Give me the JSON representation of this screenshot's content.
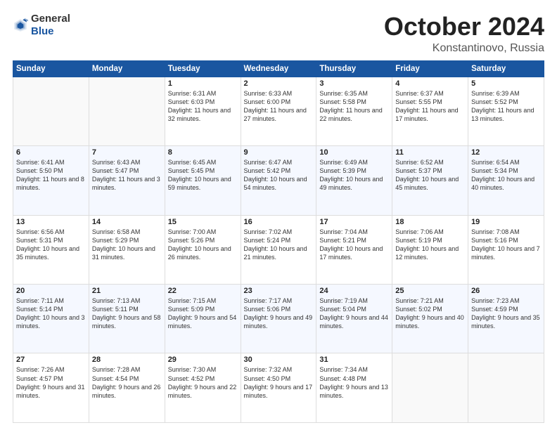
{
  "header": {
    "logo_general": "General",
    "logo_blue": "Blue",
    "month": "October 2024",
    "location": "Konstantinovo, Russia"
  },
  "weekdays": [
    "Sunday",
    "Monday",
    "Tuesday",
    "Wednesday",
    "Thursday",
    "Friday",
    "Saturday"
  ],
  "weeks": [
    [
      {
        "day": "",
        "empty": true
      },
      {
        "day": "",
        "empty": true
      },
      {
        "day": "1",
        "sunrise": "6:31 AM",
        "sunset": "6:03 PM",
        "daylight": "11 hours and 32 minutes."
      },
      {
        "day": "2",
        "sunrise": "6:33 AM",
        "sunset": "6:00 PM",
        "daylight": "11 hours and 27 minutes."
      },
      {
        "day": "3",
        "sunrise": "6:35 AM",
        "sunset": "5:58 PM",
        "daylight": "11 hours and 22 minutes."
      },
      {
        "day": "4",
        "sunrise": "6:37 AM",
        "sunset": "5:55 PM",
        "daylight": "11 hours and 17 minutes."
      },
      {
        "day": "5",
        "sunrise": "6:39 AM",
        "sunset": "5:52 PM",
        "daylight": "11 hours and 13 minutes."
      }
    ],
    [
      {
        "day": "6",
        "sunrise": "6:41 AM",
        "sunset": "5:50 PM",
        "daylight": "11 hours and 8 minutes."
      },
      {
        "day": "7",
        "sunrise": "6:43 AM",
        "sunset": "5:47 PM",
        "daylight": "11 hours and 3 minutes."
      },
      {
        "day": "8",
        "sunrise": "6:45 AM",
        "sunset": "5:45 PM",
        "daylight": "10 hours and 59 minutes."
      },
      {
        "day": "9",
        "sunrise": "6:47 AM",
        "sunset": "5:42 PM",
        "daylight": "10 hours and 54 minutes."
      },
      {
        "day": "10",
        "sunrise": "6:49 AM",
        "sunset": "5:39 PM",
        "daylight": "10 hours and 49 minutes."
      },
      {
        "day": "11",
        "sunrise": "6:52 AM",
        "sunset": "5:37 PM",
        "daylight": "10 hours and 45 minutes."
      },
      {
        "day": "12",
        "sunrise": "6:54 AM",
        "sunset": "5:34 PM",
        "daylight": "10 hours and 40 minutes."
      }
    ],
    [
      {
        "day": "13",
        "sunrise": "6:56 AM",
        "sunset": "5:31 PM",
        "daylight": "10 hours and 35 minutes."
      },
      {
        "day": "14",
        "sunrise": "6:58 AM",
        "sunset": "5:29 PM",
        "daylight": "10 hours and 31 minutes."
      },
      {
        "day": "15",
        "sunrise": "7:00 AM",
        "sunset": "5:26 PM",
        "daylight": "10 hours and 26 minutes."
      },
      {
        "day": "16",
        "sunrise": "7:02 AM",
        "sunset": "5:24 PM",
        "daylight": "10 hours and 21 minutes."
      },
      {
        "day": "17",
        "sunrise": "7:04 AM",
        "sunset": "5:21 PM",
        "daylight": "10 hours and 17 minutes."
      },
      {
        "day": "18",
        "sunrise": "7:06 AM",
        "sunset": "5:19 PM",
        "daylight": "10 hours and 12 minutes."
      },
      {
        "day": "19",
        "sunrise": "7:08 AM",
        "sunset": "5:16 PM",
        "daylight": "10 hours and 7 minutes."
      }
    ],
    [
      {
        "day": "20",
        "sunrise": "7:11 AM",
        "sunset": "5:14 PM",
        "daylight": "10 hours and 3 minutes."
      },
      {
        "day": "21",
        "sunrise": "7:13 AM",
        "sunset": "5:11 PM",
        "daylight": "9 hours and 58 minutes."
      },
      {
        "day": "22",
        "sunrise": "7:15 AM",
        "sunset": "5:09 PM",
        "daylight": "9 hours and 54 minutes."
      },
      {
        "day": "23",
        "sunrise": "7:17 AM",
        "sunset": "5:06 PM",
        "daylight": "9 hours and 49 minutes."
      },
      {
        "day": "24",
        "sunrise": "7:19 AM",
        "sunset": "5:04 PM",
        "daylight": "9 hours and 44 minutes."
      },
      {
        "day": "25",
        "sunrise": "7:21 AM",
        "sunset": "5:02 PM",
        "daylight": "9 hours and 40 minutes."
      },
      {
        "day": "26",
        "sunrise": "7:23 AM",
        "sunset": "4:59 PM",
        "daylight": "9 hours and 35 minutes."
      }
    ],
    [
      {
        "day": "27",
        "sunrise": "7:26 AM",
        "sunset": "4:57 PM",
        "daylight": "9 hours and 31 minutes."
      },
      {
        "day": "28",
        "sunrise": "7:28 AM",
        "sunset": "4:54 PM",
        "daylight": "9 hours and 26 minutes."
      },
      {
        "day": "29",
        "sunrise": "7:30 AM",
        "sunset": "4:52 PM",
        "daylight": "9 hours and 22 minutes."
      },
      {
        "day": "30",
        "sunrise": "7:32 AM",
        "sunset": "4:50 PM",
        "daylight": "9 hours and 17 minutes."
      },
      {
        "day": "31",
        "sunrise": "7:34 AM",
        "sunset": "4:48 PM",
        "daylight": "9 hours and 13 minutes."
      },
      {
        "day": "",
        "empty": true
      },
      {
        "day": "",
        "empty": true
      }
    ]
  ]
}
